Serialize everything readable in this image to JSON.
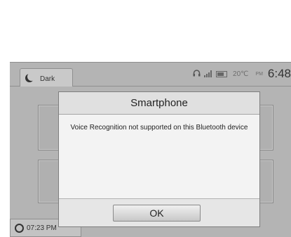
{
  "topbar": {
    "mode_label": "Dark",
    "temperature": "20℃",
    "time_suffix": "PM",
    "clock": "6:48",
    "icons": [
      "headset-icon",
      "signal-icon",
      "battery-icon"
    ]
  },
  "bottom_chip": {
    "time": "07:23 PM",
    "icon": "clock-icon"
  },
  "dialog": {
    "title": "Smartphone",
    "message": "Voice Recognition not supported on this Bluetooth device",
    "ok_label": "OK"
  }
}
